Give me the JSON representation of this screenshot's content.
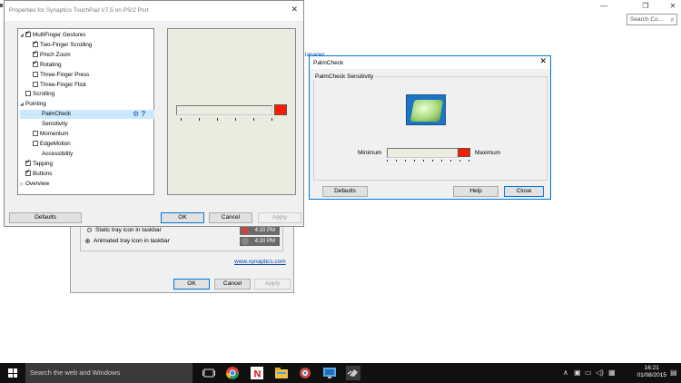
{
  "background": {
    "search_placeholder": "Search Co...",
    "link_fragment_1": "lanager",
    "back_dialog": {
      "option_static": "Static tray icon in taskbar",
      "option_animated": "Animated tray icon in taskbar",
      "clock_text": "4:20 PM",
      "link": "www.synaptics.com",
      "ok": "OK",
      "cancel": "Cancel",
      "apply": "Apply"
    }
  },
  "main_dialog": {
    "title": "Properties for Synaptics TouchPad V7.5 on PS/2 Port",
    "tree": [
      {
        "label": "MultiFinger Gestures",
        "indent": 0,
        "arrow": "◢",
        "checkbox": true,
        "checked": true
      },
      {
        "label": "Two-Finger Scrolling",
        "indent": 1,
        "checkbox": true,
        "checked": true
      },
      {
        "label": "Pinch Zoom",
        "indent": 1,
        "checkbox": true,
        "checked": true
      },
      {
        "label": "Rotating",
        "indent": 1,
        "checkbox": true,
        "checked": true
      },
      {
        "label": "Three-Finger Press",
        "indent": 1,
        "checkbox": true,
        "checked": false
      },
      {
        "label": "Three-Finger Flick",
        "indent": 1,
        "checkbox": true,
        "checked": false
      },
      {
        "label": "Scrolling",
        "indent": 0,
        "arrow": "",
        "checkbox": true,
        "checked": false
      },
      {
        "label": "Pointing",
        "indent": 0,
        "arrow": "◢",
        "checkbox": false,
        "checked": false
      },
      {
        "label": "PalmCheck",
        "indent": 1,
        "checkbox": false,
        "checked": false,
        "selected": true
      },
      {
        "label": "Sensitivity",
        "indent": 1,
        "checkbox": false,
        "checked": false
      },
      {
        "label": "Momentum",
        "indent": 1,
        "checkbox": true,
        "checked": false
      },
      {
        "label": "EdgeMotion",
        "indent": 1,
        "checkbox": true,
        "checked": false
      },
      {
        "label": "Accessibility",
        "indent": 1,
        "checkbox": false,
        "checked": false
      },
      {
        "label": "Tapping",
        "indent": 0,
        "arrow": "",
        "checkbox": true,
        "checked": true
      },
      {
        "label": "Buttons",
        "indent": 0,
        "arrow": "",
        "checkbox": true,
        "checked": true
      },
      {
        "label": "Overview",
        "indent": 0,
        "arrow": "▷",
        "checkbox": false,
        "checked": false
      }
    ],
    "slider_value": 1.0,
    "defaults": "Defaults",
    "ok": "OK",
    "cancel": "Cancel",
    "apply": "Apply"
  },
  "palm_dialog": {
    "title": "PalmCheck",
    "group_label": "PalmCheck Sensitivity",
    "minimum": "Minimum",
    "maximum": "Maximum",
    "slider_value": 1.0,
    "defaults": "Defaults",
    "help": "Help",
    "close": "Close"
  },
  "taskbar": {
    "search_text": "Search the web and Windows",
    "time": "16:21",
    "date": "01/08/2015"
  },
  "colors": {
    "slider_thumb": "#ff1a00",
    "selection": "#cce8ff",
    "taskbar": "#101010",
    "accent": "#0078d7"
  }
}
